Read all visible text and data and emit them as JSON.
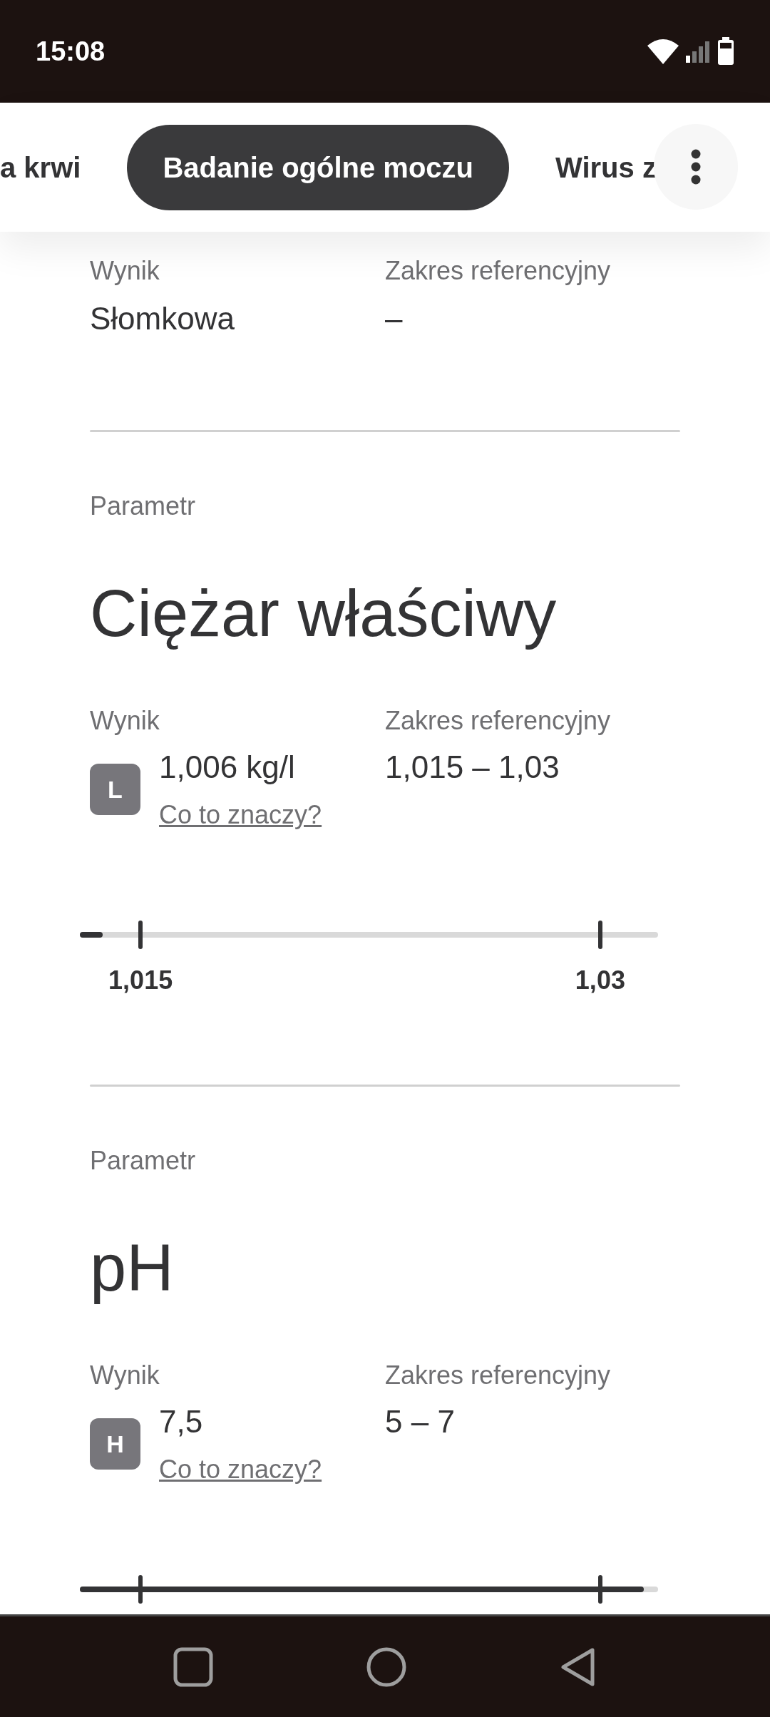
{
  "status_bar": {
    "time": "15:08"
  },
  "tabs": [
    {
      "label": "a krwi",
      "selected": false
    },
    {
      "label": "Badanie ogólne moczu",
      "selected": true
    },
    {
      "label": "Wirus z",
      "selected": false
    }
  ],
  "top_card": {
    "result_label": "Wynik",
    "result": "Słomkowa",
    "range_label": "Zakres referencyjny",
    "range": "–"
  },
  "parameters": [
    {
      "param_label": "Parametr",
      "name": "Ciężar właściwy",
      "result_label": "Wynik",
      "flag": "L",
      "result": "1,006 kg/l",
      "link": "Co to znaczy?",
      "range_label": "Zakres referencyjny",
      "range": "1,015 – 1,03",
      "scale": {
        "level": 0.04,
        "low": "1,015",
        "high": "1,03"
      }
    },
    {
      "param_label": "Parametr",
      "name": "pH",
      "result_label": "Wynik",
      "flag": "H",
      "result": "7,5",
      "link": "Co to znaczy?",
      "range_label": "Zakres referencyjny",
      "range": "5 – 7",
      "scale": {
        "level": 0.975
      }
    }
  ]
}
